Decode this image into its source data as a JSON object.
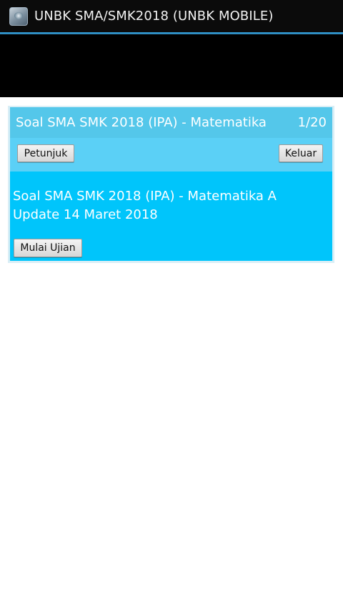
{
  "window": {
    "title": "UNBK SMA/SMK2018 (UNBK MOBILE)",
    "app_icon": "app-icon"
  },
  "card": {
    "header": {
      "subject": "Soal SMA SMK 2018 (IPA) - Matematika",
      "page_indicator": "1/20"
    },
    "toolbar": {
      "help_label": "Petunjuk",
      "exit_label": "Keluar"
    },
    "content": {
      "description": "Soal SMA SMK 2018 (IPA) - Matematika A\nUpdate 14 Maret 2018",
      "start_label": "Mulai Ujian"
    }
  },
  "colors": {
    "titlebar": "#0b0b0b",
    "header": "#54c7ea",
    "toolbar": "#5bd0f6",
    "content": "#00c5fb"
  }
}
